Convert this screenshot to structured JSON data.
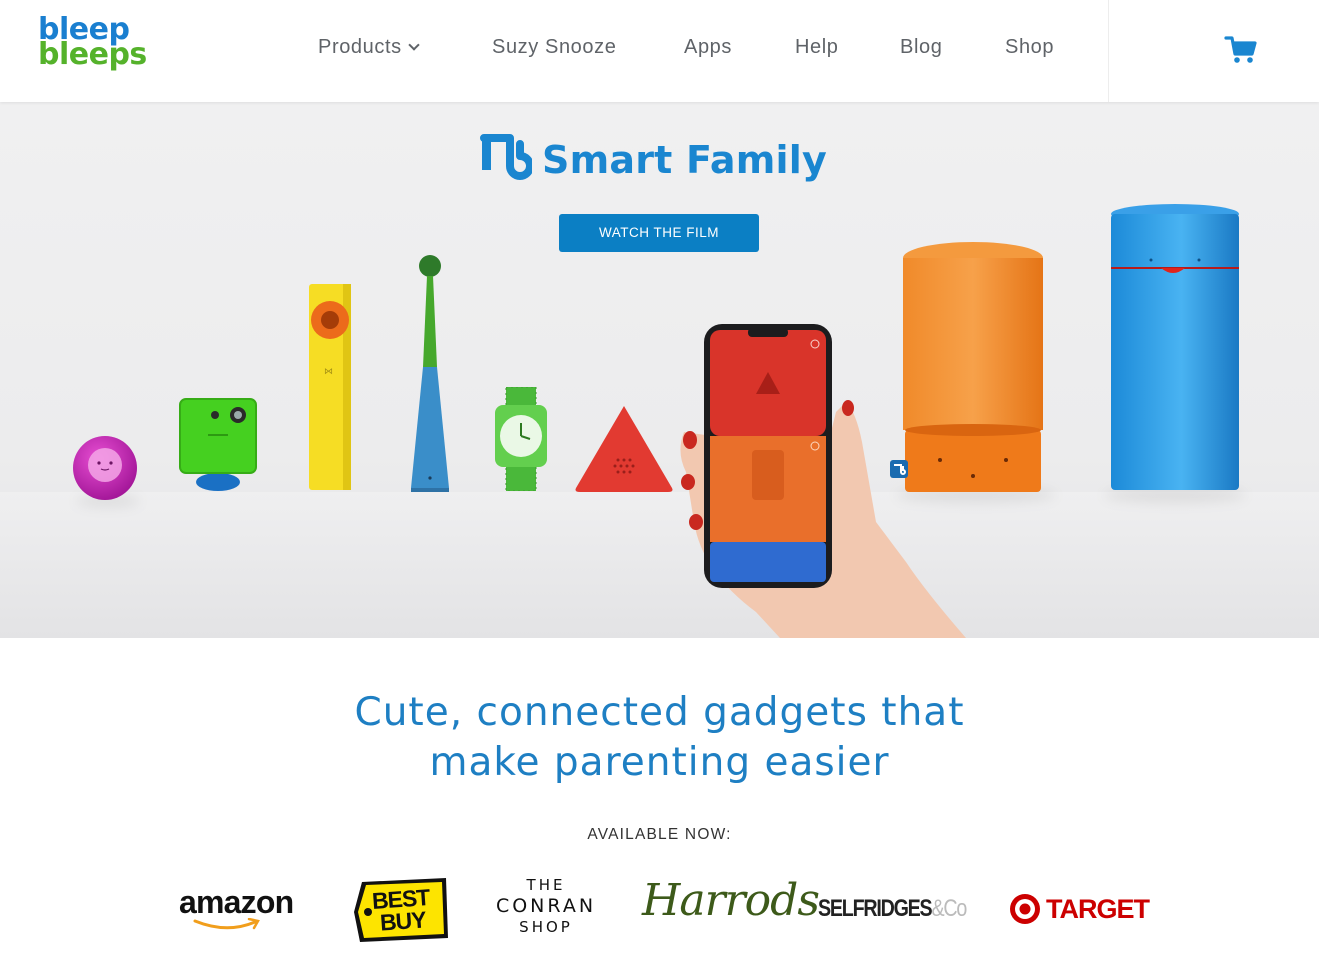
{
  "brand": {
    "logo_line1": "bleep",
    "logo_line2": "bleeps"
  },
  "nav": {
    "items": [
      {
        "label": "Products",
        "has_dropdown": true
      },
      {
        "label": "Suzy Snooze"
      },
      {
        "label": "Apps"
      },
      {
        "label": "Help"
      },
      {
        "label": "Blog"
      },
      {
        "label": "Shop"
      }
    ],
    "cart_icon": "cart-icon"
  },
  "hero": {
    "title": "Smart Family",
    "cta_label": "WATCH THE FILM"
  },
  "main": {
    "tagline_line1": "Cute, connected gadgets that",
    "tagline_line2": "make parenting easier",
    "available_label": "AVAILABLE NOW:"
  },
  "retailers": {
    "amazon": "amazon",
    "bestbuy_line1": "BEST",
    "bestbuy_line2": "BUY",
    "conran_line1": "THE",
    "conran_line2": "CONRAN",
    "conran_line3": "SHOP",
    "harrods": "Harrods",
    "selfridges": "SELFRIDGES",
    "selfridges_co": "&Co",
    "target": "TARGET"
  },
  "colors": {
    "brand_blue": "#1a7fd0",
    "brand_green": "#55b22b",
    "cta_blue": "#0b7fc4",
    "tagline_blue": "#1e7fc3"
  }
}
